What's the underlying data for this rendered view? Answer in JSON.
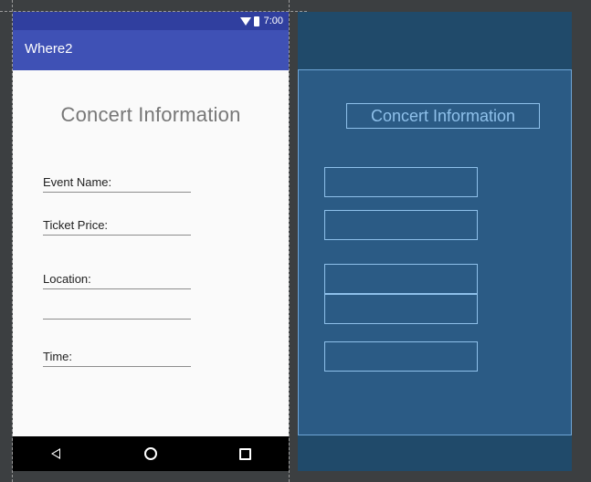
{
  "status_bar": {
    "time": "7:00"
  },
  "app_bar": {
    "title": "Where2"
  },
  "screen": {
    "title": "Concert Information",
    "fields": [
      {
        "label": "Event Name:"
      },
      {
        "label": "Ticket Price:"
      },
      {
        "label": "Location:"
      },
      {
        "label": ""
      },
      {
        "label": "Time:"
      }
    ]
  },
  "navigation": {
    "icons": [
      "back-icon",
      "home-icon",
      "recent-apps-icon"
    ]
  },
  "blueprint": {
    "title": "Concert Information"
  },
  "colors": {
    "status_bar": "#303f9f",
    "app_bar": "#3f51b5",
    "blueprint_bg": "#204a6a",
    "blueprint_outline": "#8ec0ea"
  }
}
